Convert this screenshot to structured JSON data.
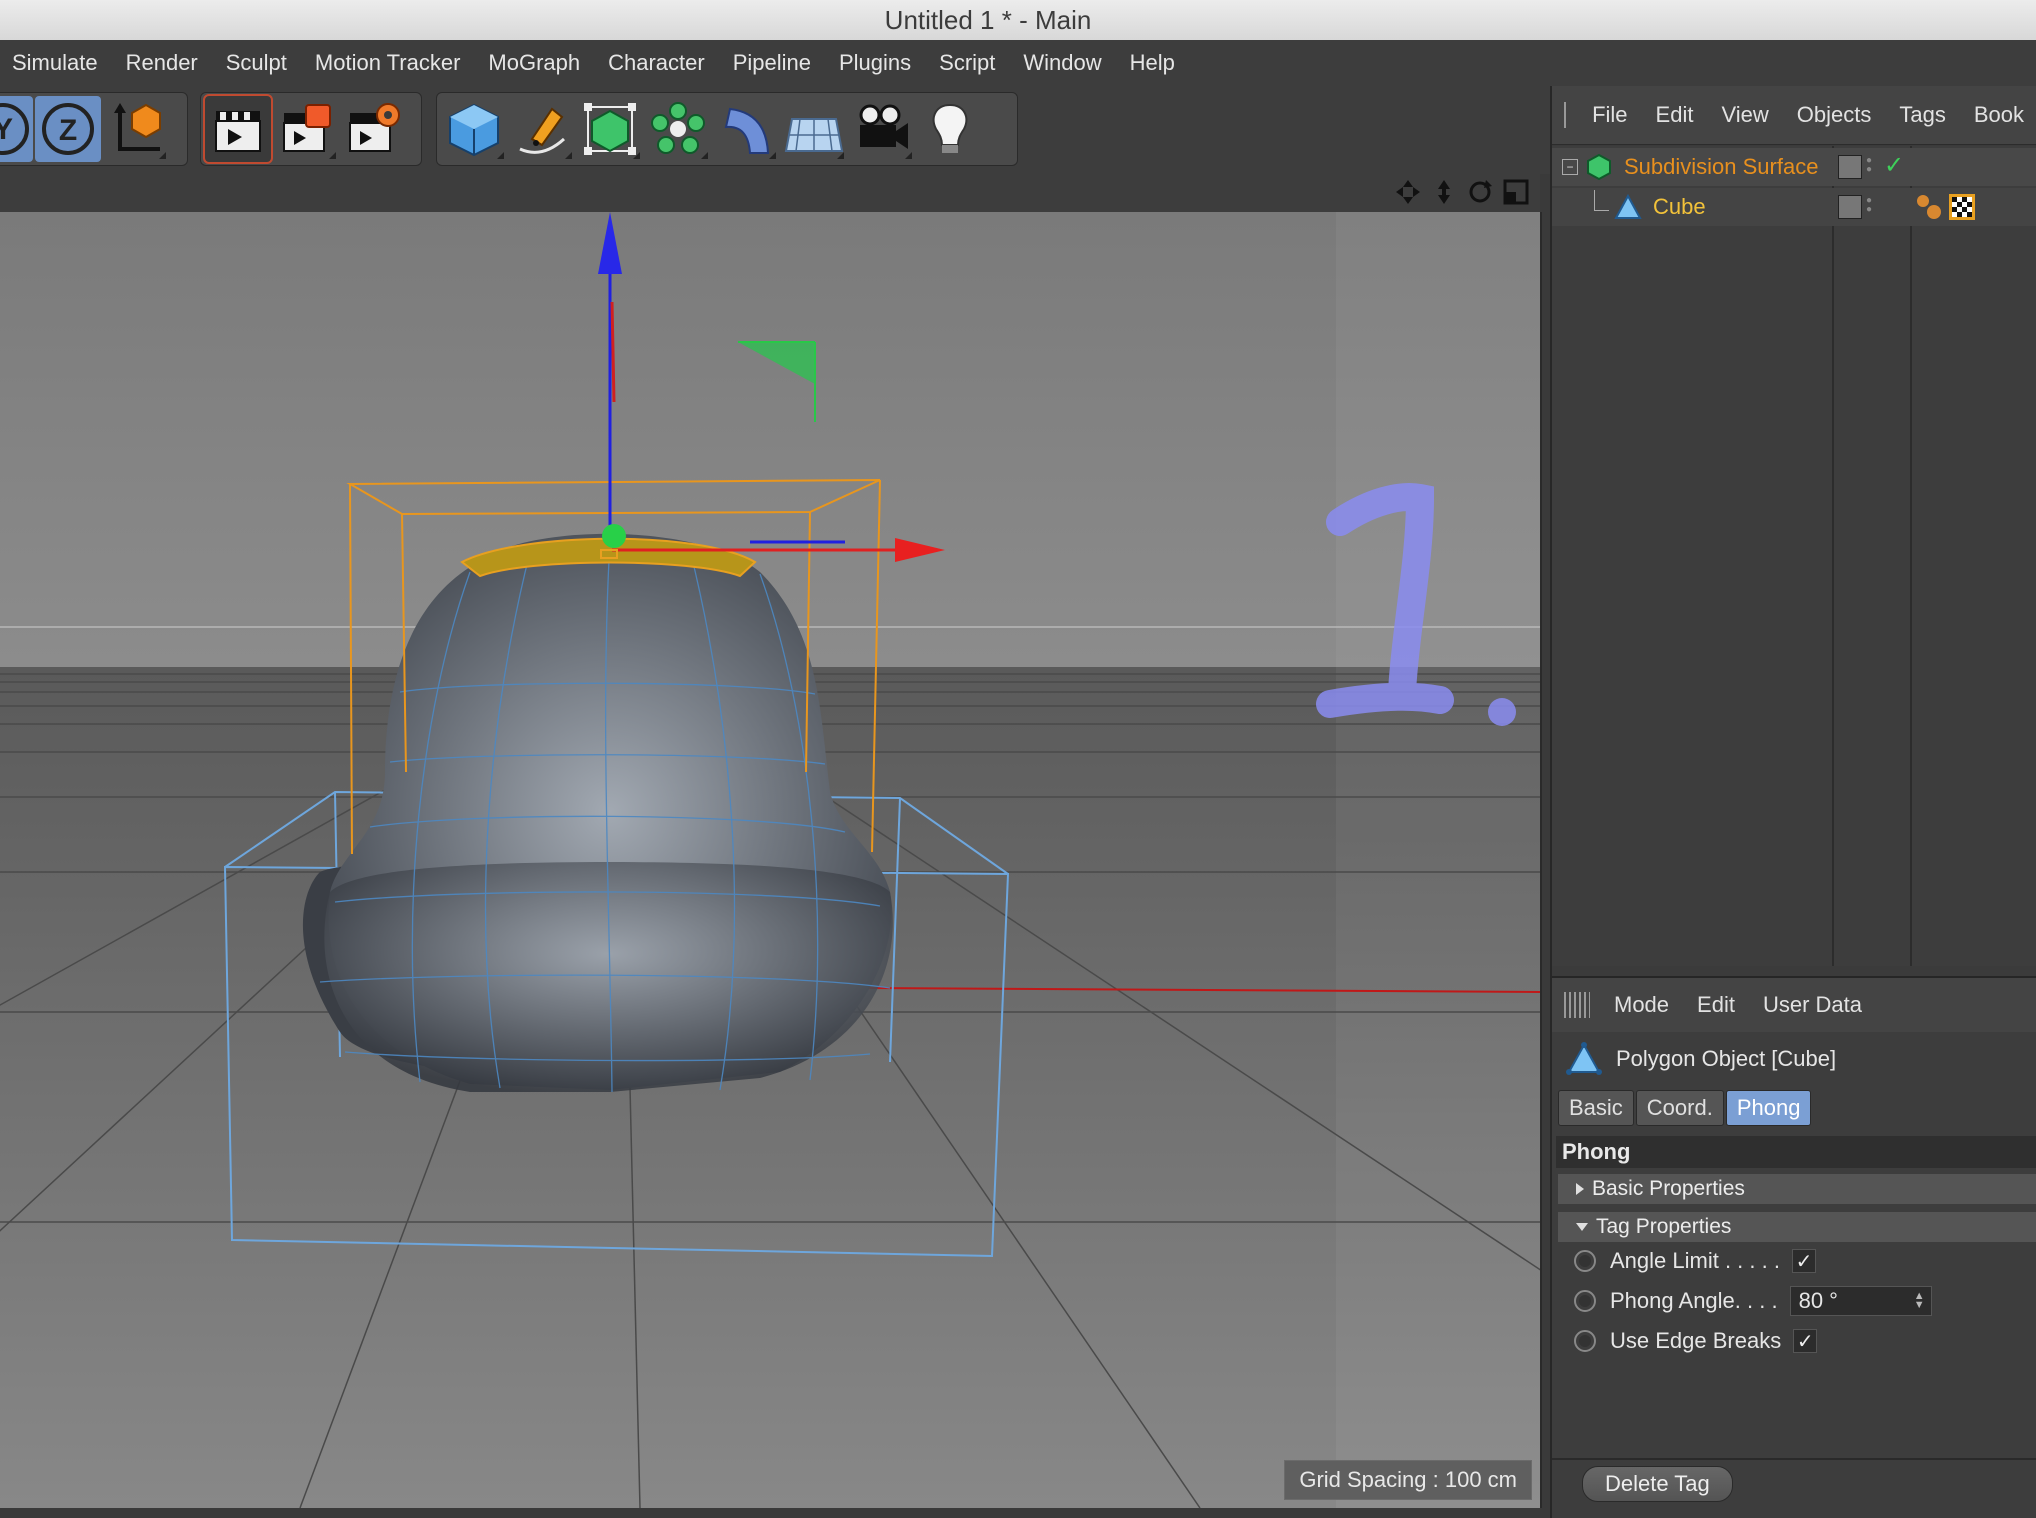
{
  "window": {
    "title": "Untitled 1 * - Main"
  },
  "menubar": [
    "Simulate",
    "Render",
    "Sculpt",
    "Motion Tracker",
    "MoGraph",
    "Character",
    "Pipeline",
    "Plugins",
    "Script",
    "Window",
    "Help"
  ],
  "toolbar": {
    "axis_y": "Y",
    "axis_z": "Z"
  },
  "viewport": {
    "grid_spacing": "Grid Spacing : 100 cm",
    "annotation": "1."
  },
  "object_manager": {
    "menu": [
      "File",
      "Edit",
      "View",
      "Objects",
      "Tags",
      "Book"
    ],
    "objects": [
      {
        "name": "Subdivision Surface",
        "color": "#e8901e",
        "enabled": true
      },
      {
        "name": "Cube",
        "color": "#f2c23a"
      }
    ]
  },
  "attribute_manager": {
    "menu": [
      "Mode",
      "Edit",
      "User Data"
    ],
    "object_title": "Polygon Object [Cube]",
    "tabs": [
      {
        "label": "Basic",
        "active": false
      },
      {
        "label": "Coord.",
        "active": false
      },
      {
        "label": "Phong",
        "active": true
      }
    ],
    "section": "Phong",
    "groups": {
      "basic": "Basic Properties",
      "tag": "Tag Properties"
    },
    "properties": {
      "angle_limit": {
        "label": "Angle Limit . . . . .",
        "checked": true
      },
      "phong_angle": {
        "label": "Phong Angle. . . .",
        "value": "80 °"
      },
      "edge_breaks": {
        "label": "Use Edge Breaks",
        "checked": true
      }
    },
    "delete_button": "Delete Tag",
    "check_mark": "✓"
  }
}
